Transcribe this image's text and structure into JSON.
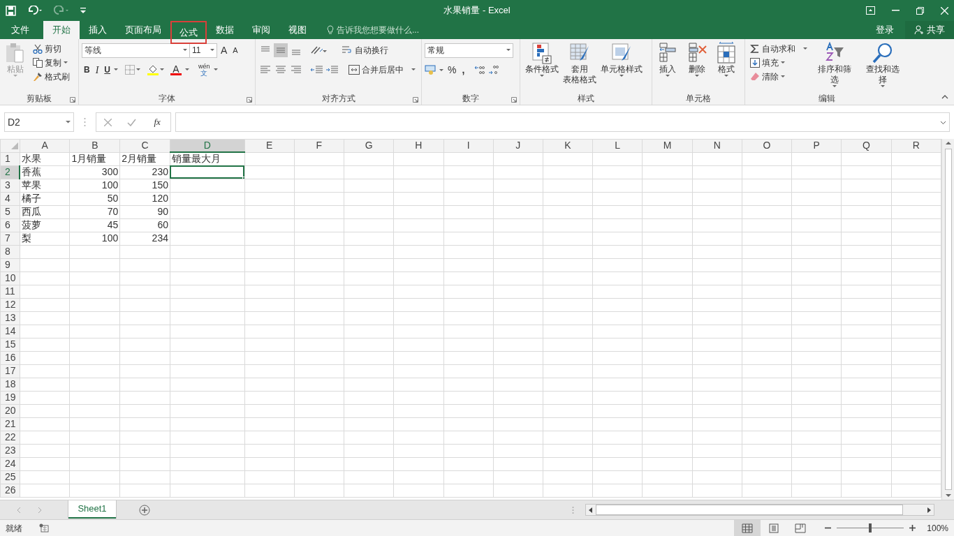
{
  "window": {
    "title": "水果销量 - Excel"
  },
  "tabs": [
    {
      "label": "文件",
      "kind": "file",
      "selected": false,
      "outlined": false
    },
    {
      "label": "开始",
      "kind": "tab",
      "selected": true,
      "outlined": false
    },
    {
      "label": "插入",
      "kind": "tab",
      "selected": false,
      "outlined": false
    },
    {
      "label": "页面布局",
      "kind": "tab",
      "selected": false,
      "outlined": false
    },
    {
      "label": "公式",
      "kind": "tab",
      "selected": false,
      "outlined": true
    },
    {
      "label": "数据",
      "kind": "tab",
      "selected": false,
      "outlined": false
    },
    {
      "label": "审阅",
      "kind": "tab",
      "selected": false,
      "outlined": false
    },
    {
      "label": "视图",
      "kind": "tab",
      "selected": false,
      "outlined": false
    }
  ],
  "tell_me": {
    "text": "告诉我您想要做什么..."
  },
  "account": {
    "sign_in": "登录",
    "share": "共享"
  },
  "ribbon": {
    "clipboard": {
      "paste": "粘贴",
      "cut": "剪切",
      "copy": "复制",
      "format_painter": "格式刷",
      "label": "剪贴板"
    },
    "font": {
      "font_name": "等线",
      "font_size": "11",
      "grow": "A",
      "shrink": "A",
      "bold": "B",
      "italic": "I",
      "underline": "U",
      "font_color": "A",
      "phonetic": "wén",
      "phonetic_char": "文",
      "label": "字体"
    },
    "alignment": {
      "wrap_text": "自动换行",
      "merge_center": "合并后居中",
      "label": "对齐方式"
    },
    "number": {
      "format": "常规",
      "percent": "%",
      "comma": ",",
      "label": "数字"
    },
    "styles": {
      "conditional": "条件格式",
      "table_format_line1": "套用",
      "table_format_line2": "表格格式",
      "cell_styles": "单元格样式",
      "label": "样式"
    },
    "cells": {
      "insert": "插入",
      "delete": "删除",
      "format": "格式",
      "label": "单元格"
    },
    "editing": {
      "autosum": "自动求和",
      "fill": "填充",
      "clear": "清除",
      "sort_filter": "排序和筛选",
      "find_select": "查找和选择",
      "label": "编辑"
    }
  },
  "formula_bar": {
    "name_box": "D2",
    "function_label": "fx"
  },
  "columns": [
    {
      "label": "A",
      "selected": false
    },
    {
      "label": "B",
      "selected": false
    },
    {
      "label": "C",
      "selected": false
    },
    {
      "label": "D",
      "selected": true
    },
    {
      "label": "E",
      "selected": false
    },
    {
      "label": "F",
      "selected": false
    },
    {
      "label": "G",
      "selected": false
    },
    {
      "label": "H",
      "selected": false
    },
    {
      "label": "I",
      "selected": false
    },
    {
      "label": "J",
      "selected": false
    },
    {
      "label": "K",
      "selected": false
    },
    {
      "label": "L",
      "selected": false
    },
    {
      "label": "M",
      "selected": false
    },
    {
      "label": "N",
      "selected": false
    },
    {
      "label": "O",
      "selected": false
    },
    {
      "label": "P",
      "selected": false
    },
    {
      "label": "Q",
      "selected": false
    },
    {
      "label": "R",
      "selected": false
    }
  ],
  "rows": [
    {
      "label": "1",
      "selected": false,
      "cells": [
        {
          "text": "水果",
          "kind": "text",
          "selected": false
        },
        {
          "text": "1月销量",
          "kind": "text",
          "selected": false
        },
        {
          "text": "2月销量",
          "kind": "text",
          "selected": false
        },
        {
          "text": "销量最大月",
          "kind": "text",
          "selected": false
        }
      ]
    },
    {
      "label": "2",
      "selected": true,
      "cells": [
        {
          "text": "香蕉",
          "kind": "text",
          "selected": false
        },
        {
          "text": "300",
          "kind": "number",
          "selected": false
        },
        {
          "text": "230",
          "kind": "number",
          "selected": false
        },
        {
          "selected": true
        }
      ]
    },
    {
      "label": "3",
      "selected": false,
      "cells": [
        {
          "text": "苹果",
          "kind": "text",
          "selected": false
        },
        {
          "text": "100",
          "kind": "number",
          "selected": false
        },
        {
          "text": "150",
          "kind": "number",
          "selected": false
        }
      ]
    },
    {
      "label": "4",
      "selected": false,
      "cells": [
        {
          "text": "橘子",
          "kind": "text",
          "selected": false
        },
        {
          "text": "50",
          "kind": "number",
          "selected": false
        },
        {
          "text": "120",
          "kind": "number",
          "selected": false
        }
      ]
    },
    {
      "label": "5",
      "selected": false,
      "cells": [
        {
          "text": "西瓜",
          "kind": "text",
          "selected": false
        },
        {
          "text": "70",
          "kind": "number",
          "selected": false
        },
        {
          "text": "90",
          "kind": "number",
          "selected": false
        }
      ]
    },
    {
      "label": "6",
      "selected": false,
      "cells": [
        {
          "text": "菠萝",
          "kind": "text",
          "selected": false
        },
        {
          "text": "45",
          "kind": "number",
          "selected": false
        },
        {
          "text": "60",
          "kind": "number",
          "selected": false
        }
      ]
    },
    {
      "label": "7",
      "selected": false,
      "cells": [
        {
          "text": "梨",
          "kind": "text",
          "selected": false
        },
        {
          "text": "100",
          "kind": "number",
          "selected": false
        },
        {
          "text": "234",
          "kind": "number",
          "selected": false
        }
      ]
    },
    {
      "label": "8",
      "selected": false
    },
    {
      "label": "9",
      "selected": false
    },
    {
      "label": "10",
      "selected": false
    },
    {
      "label": "11",
      "selected": false
    },
    {
      "label": "12",
      "selected": false
    },
    {
      "label": "13",
      "selected": false
    },
    {
      "label": "14",
      "selected": false
    },
    {
      "label": "15",
      "selected": false
    },
    {
      "label": "16",
      "selected": false
    },
    {
      "label": "17",
      "selected": false
    },
    {
      "label": "18",
      "selected": false
    },
    {
      "label": "19",
      "selected": false
    },
    {
      "label": "20",
      "selected": false
    },
    {
      "label": "21",
      "selected": false
    },
    {
      "label": "22",
      "selected": false
    },
    {
      "label": "23",
      "selected": false
    },
    {
      "label": "24",
      "selected": false
    },
    {
      "label": "25",
      "selected": false
    },
    {
      "label": "26",
      "selected": false
    }
  ],
  "sheet_tabs": [
    {
      "label": "Sheet1",
      "selected": true
    }
  ],
  "status_bar": {
    "status": "就绪",
    "views": [
      {
        "kind": "normal",
        "selected": true
      },
      {
        "kind": "page_layout",
        "selected": false
      },
      {
        "kind": "page_break",
        "selected": false
      }
    ],
    "zoom": {
      "level": 0.5,
      "reading": "100%"
    }
  }
}
